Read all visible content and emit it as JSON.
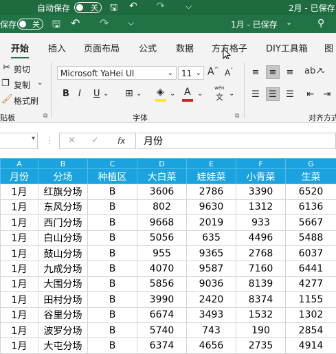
{
  "back_window": {
    "autosave_label": "自动保存",
    "autosave_state": "关",
    "doc_title": "2月 - 已保存"
  },
  "window": {
    "autosave_label": "保存",
    "autosave_state": "关",
    "doc_title": "1月 - 已保存"
  },
  "ribbon_tabs": [
    "开始",
    "插入",
    "页面布局",
    "公式",
    "数据",
    "方方格子",
    "DIY工具箱",
    "图"
  ],
  "active_tab": "开始",
  "clipboard": {
    "cut": "剪切",
    "copy": "复制",
    "format_painter": "格式刷",
    "group_label": "贴板"
  },
  "font": {
    "name": "Microsoft YaHei UI",
    "size": "11",
    "group_label": "字体",
    "bold": "B",
    "italic": "I",
    "underline": "U",
    "font_color_letter": "A",
    "phonetic": "wén",
    "phonetic_char": "文"
  },
  "alignment": {
    "group_label": "对齐方式"
  },
  "colors": {
    "title_bar": "#217346",
    "header_fill": "#1aa3df",
    "font_color_underline": "#e02020",
    "fill_color_underline": "#ffee00"
  },
  "formula_bar": {
    "name_box": "",
    "cancel": "✕",
    "enter": "✓",
    "fx": "fx",
    "content": "月份"
  },
  "column_letters": [
    "A",
    "B",
    "C",
    "D",
    "E",
    "F",
    "G"
  ],
  "table": {
    "headers": [
      "月份",
      "分场",
      "种植区",
      "大白菜",
      "娃娃菜",
      "小青菜",
      "生菜"
    ],
    "rows": [
      [
        "1月",
        "红旗分场",
        "B",
        "3606",
        "2786",
        "3390",
        "6520"
      ],
      [
        "1月",
        "东风分场",
        "B",
        "802",
        "9630",
        "1312",
        "6136"
      ],
      [
        "1月",
        "西门分场",
        "B",
        "9668",
        "2019",
        "933",
        "5667"
      ],
      [
        "1月",
        "白山分场",
        "B",
        "5056",
        "635",
        "4496",
        "5488"
      ],
      [
        "1月",
        "鼓山分场",
        "B",
        "955",
        "9365",
        "2768",
        "6037"
      ],
      [
        "1月",
        "九成分场",
        "B",
        "4070",
        "9587",
        "7160",
        "6441"
      ],
      [
        "1月",
        "大围分场",
        "B",
        "5856",
        "9036",
        "8139",
        "4277"
      ],
      [
        "1月",
        "田村分场",
        "B",
        "3990",
        "2420",
        "8374",
        "1155"
      ],
      [
        "1月",
        "谷里分场",
        "B",
        "6674",
        "3493",
        "1532",
        "1302"
      ],
      [
        "1月",
        "波罗分场",
        "B",
        "5740",
        "743",
        "190",
        "2854"
      ],
      [
        "1月",
        "大屯分场",
        "B",
        "6374",
        "4656",
        "2735",
        "4914"
      ]
    ]
  }
}
